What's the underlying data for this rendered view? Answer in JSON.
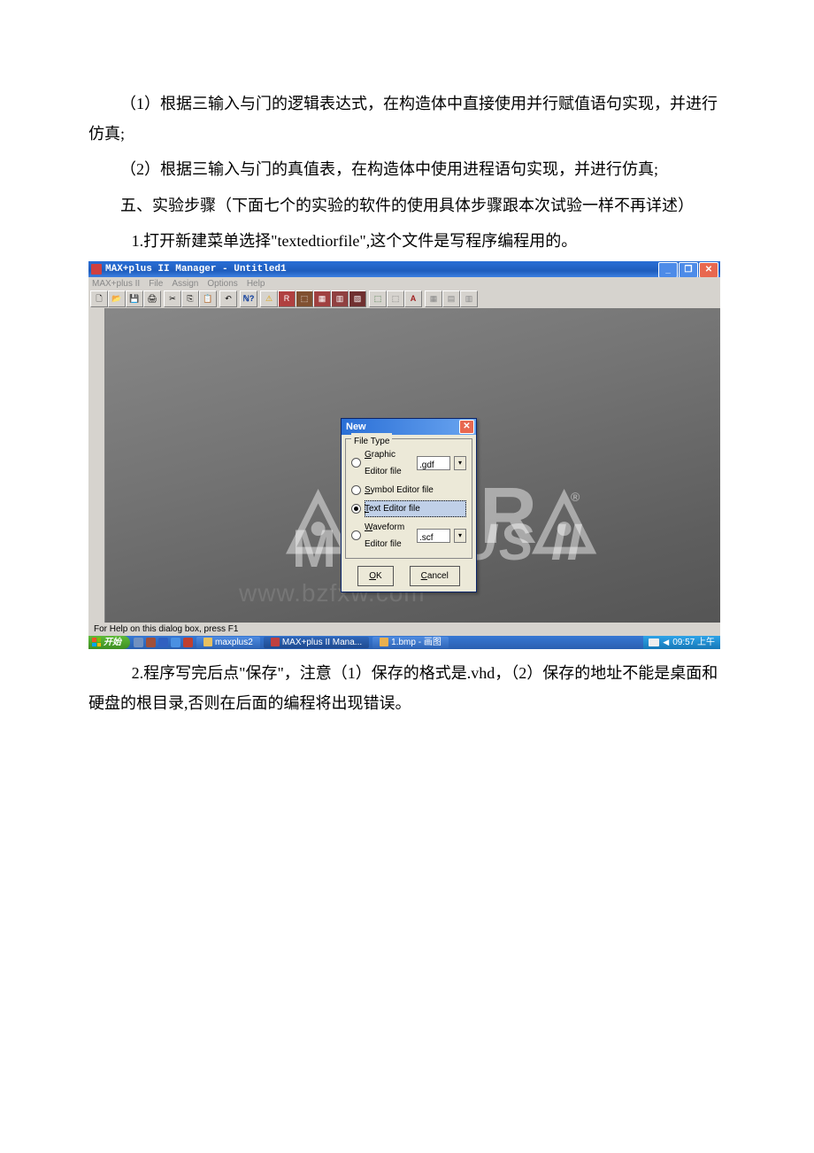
{
  "doc": {
    "p1": "（1）根据三输入与门的逻辑表达式，在构造体中直接使用并行赋值语句实现，并进行仿真;",
    "p2": "（2）根据三输入与门的真值表，在构造体中使用进程语句实现，并进行仿真;",
    "p3": "五、实验步骤（下面七个的实验的软件的使用具体步骤跟本次试验一样不再详述）",
    "p4": "1.打开新建菜单选择\"textedtiorfile\",这个文件是写程序编程用的。",
    "p5": "2.程序写完后点\"保存\"，注意（1）保存的格式是.vhd，（2）保存的地址不能是桌面和硬盘的根目录,否则在后面的编程将出现错误。"
  },
  "app": {
    "title": "MAX+plus II Manager - Untitled1",
    "menus": [
      "MAX+plus II",
      "File",
      "Assign",
      "Options",
      "Help"
    ],
    "status": "For Help on this dialog box, press F1"
  },
  "dialog": {
    "title": "New",
    "group": "File Type",
    "opt1": "Graphic Editor file",
    "opt2": "Symbol Editor file",
    "opt3": "Text Editor file",
    "opt4": "Waveform Editor file",
    "ext1": ".gdf",
    "ext4": ".scf",
    "ok": "OK",
    "cancel": "Cancel"
  },
  "taskbar": {
    "start": "开始",
    "task1": "maxplus2",
    "task2": "MAX+plus II Mana...",
    "task3": "1.bmp - 画图",
    "clock": "09:57 上午"
  },
  "watermark": {
    "url": "www.bzfxw.com"
  }
}
